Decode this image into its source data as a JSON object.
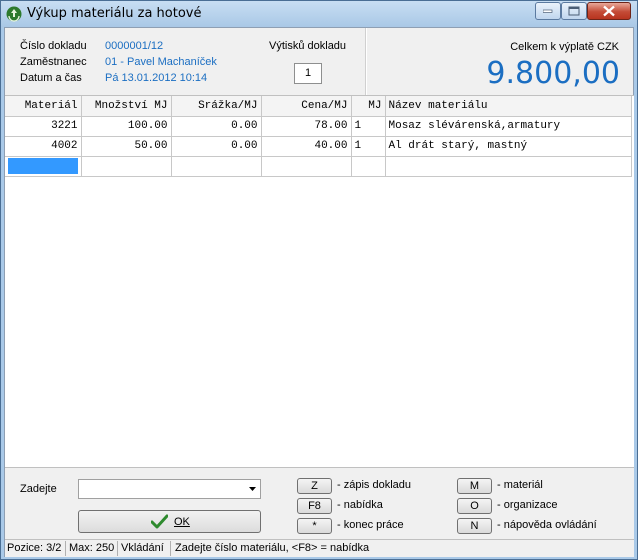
{
  "window": {
    "title": "Výkup materiálu za hotové",
    "icon": "recycle-icon"
  },
  "header": {
    "doc_number_label": "Číslo dokladu",
    "doc_number_value": "0000001/12",
    "employee_label": "Zaměstnanec",
    "employee_value": "01 - Pavel Machaníček",
    "datetime_label": "Datum a čas",
    "datetime_value": "Pá 13.01.2012 10:14",
    "copies_label": "Výtisků dokladu",
    "copies_value": "1"
  },
  "total": {
    "label": "Celkem k výplatě CZK",
    "value": "9.800,00",
    "color": "#1b6ec2"
  },
  "table": {
    "columns": [
      "Materiál",
      "Množství MJ",
      "Srážka/MJ",
      "Cena/MJ",
      "MJ",
      "Název materiálu"
    ],
    "rows": [
      [
        "3221",
        "100.00",
        "0.00",
        "78.00",
        "1",
        "Mosaz slévárenská,armatury"
      ],
      [
        "4002",
        "50.00",
        "0.00",
        "40.00",
        "1",
        "Al drát starý, mastný"
      ]
    ],
    "selection_color": "#3399ff"
  },
  "footer": {
    "input_label": "Zadejte",
    "input_value": "",
    "ok_label": "OK",
    "shortcuts": [
      {
        "key": "Z",
        "desc": "- zápis dokladu"
      },
      {
        "key": "F8",
        "desc": "- nabídka"
      },
      {
        "key": "*",
        "desc": "- konec práce"
      },
      {
        "key": "M",
        "desc": "- materiál"
      },
      {
        "key": "O",
        "desc": "- organizace"
      },
      {
        "key": "N",
        "desc": "- nápověda ovládání"
      }
    ]
  },
  "statusbar": {
    "position": "Pozice: 3/2",
    "max": "Max: 250",
    "mode": "Vkládání",
    "hint": "Zadejte číslo materiálu, <F8> = nabídka"
  }
}
